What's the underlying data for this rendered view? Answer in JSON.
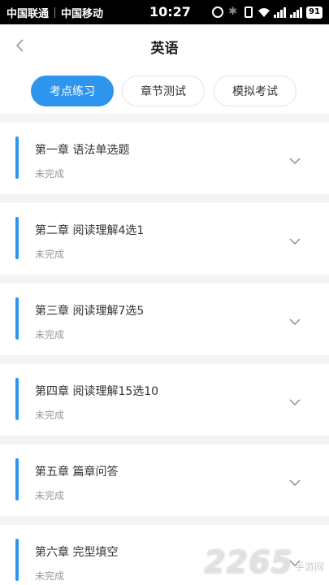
{
  "status_bar": {
    "carrier1": "中国联通",
    "carrier2": "中国移动",
    "time": "10:27",
    "battery": "91"
  },
  "header": {
    "title": "英语"
  },
  "tabs": [
    {
      "label": "考点练习",
      "active": true
    },
    {
      "label": "章节测试",
      "active": false
    },
    {
      "label": "模拟考试",
      "active": false
    }
  ],
  "chapters": [
    {
      "title": "第一章 语法单选题",
      "status": "未完成"
    },
    {
      "title": "第二章 阅读理解4选1",
      "status": "未完成"
    },
    {
      "title": "第三章 阅读理解7选5",
      "status": "未完成"
    },
    {
      "title": "第四章 阅读理解15选10",
      "status": "未完成"
    },
    {
      "title": "第五章 篇章问答",
      "status": "未完成"
    },
    {
      "title": "第六章 完型填空",
      "status": "未完成"
    }
  ],
  "watermark": {
    "number": "2265",
    "text": "手游网"
  },
  "colors": {
    "accent": "#2e95ee",
    "background": "#f4f4f4"
  }
}
